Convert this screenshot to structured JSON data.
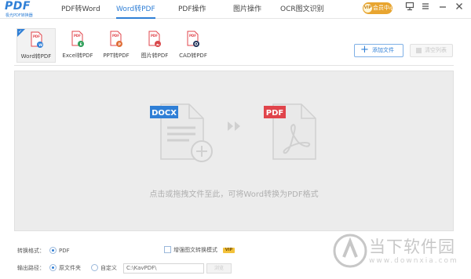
{
  "logo": {
    "title": "PDF",
    "subtitle": "极光PDF转换器"
  },
  "nav": {
    "tabs": [
      {
        "label": "PDF转Word"
      },
      {
        "label": "Word转PDF"
      },
      {
        "label": "PDF操作"
      },
      {
        "label": "图片操作"
      },
      {
        "label": "OCR图文识别"
      }
    ],
    "active_index": 1
  },
  "vip": {
    "badge": "VIP",
    "label": "会员中心"
  },
  "tools": [
    {
      "label": "Word转PDF",
      "badge_color": "#2f7fd6",
      "selected": true
    },
    {
      "label": "Excel转PDF",
      "badge_color": "#2fa05a",
      "selected": false
    },
    {
      "label": "PPT转PDF",
      "badge_color": "#e0703a",
      "selected": false
    },
    {
      "label": "图片转PDF",
      "badge_color": "#d9484b",
      "selected": false
    },
    {
      "label": "CAD转PDF",
      "badge_color": "#24365c",
      "selected": false
    }
  ],
  "actions": {
    "add_label": "添加文件",
    "clear_label": "清空列表"
  },
  "dropzone": {
    "from_tag": "DOCX",
    "to_tag": "PDF",
    "hint": "点击或拖拽文件至此，可将Word转换为PDF格式"
  },
  "options": {
    "format_label": "转换格式：",
    "format_value": "PDF",
    "enhance_label": "增强图文转换模式",
    "enhance_badge": "VIP",
    "output_label": "输出路径：",
    "output_source": "原文件夹",
    "output_custom": "自定义",
    "output_path": "C:\\KavPDF\\",
    "browse_label": "浏览"
  },
  "watermark": {
    "title": "当下软件园",
    "subtitle": "www.downxia.com"
  },
  "colors": {
    "accent": "#2f7fd6",
    "docx_tag": "#2f7fd6",
    "pdf_tag": "#e0444b",
    "vip": "#e8a530"
  }
}
